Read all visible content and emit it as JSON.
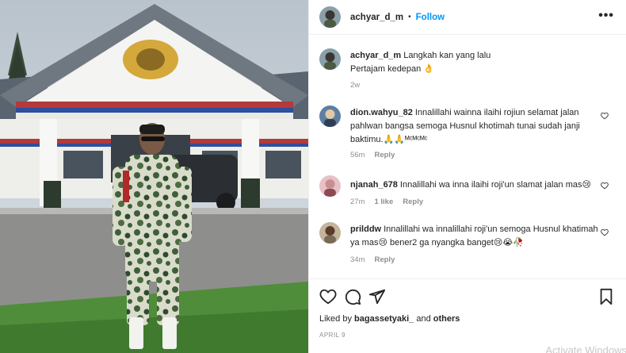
{
  "post": {
    "username": "achyar_d_m",
    "separator": "•",
    "follow_label": "Follow",
    "more_icon": "more-horizontal-icon"
  },
  "comments": [
    {
      "username": "achyar_d_m",
      "text_line1": "Langkah kan yang lalu",
      "text_line2": "Pertajam kedepan 👌",
      "time": "2w"
    },
    {
      "username": "dion.wahyu_82",
      "text": "Innalillahi wainna ilaihi rojiun selamat jalan pahlwan bangsa semoga Husnul khotimah tunai sudah janji baktimu.🙏🙏ᴹᶜᴹᶜᴹᶜ",
      "time": "56m",
      "reply_label": "Reply"
    },
    {
      "username": "njanah_678",
      "text": "Innalillahi wa inna ilaihi roji'un slamat jalan mas😢",
      "time": "27m",
      "likes": "1 like",
      "reply_label": "Reply"
    },
    {
      "username": "prilddw",
      "text": "Innalillahi wa innalillahi roji'un semoga Husnul khatimah ya mas😢 bener2 ga nyangka banget😢😭🥀",
      "time": "34m",
      "reply_label": "Reply"
    }
  ],
  "footer": {
    "liked_by_prefix": "Liked by",
    "liked_by_user": "bagassetyaki_",
    "liked_by_and": "and",
    "liked_by_others": "others",
    "date": "APRIL 9",
    "watermark": "Activate Windows"
  },
  "colors": {
    "follow_blue": "#0095f6",
    "meta_gray": "#8e8e8e",
    "text": "#262626"
  }
}
